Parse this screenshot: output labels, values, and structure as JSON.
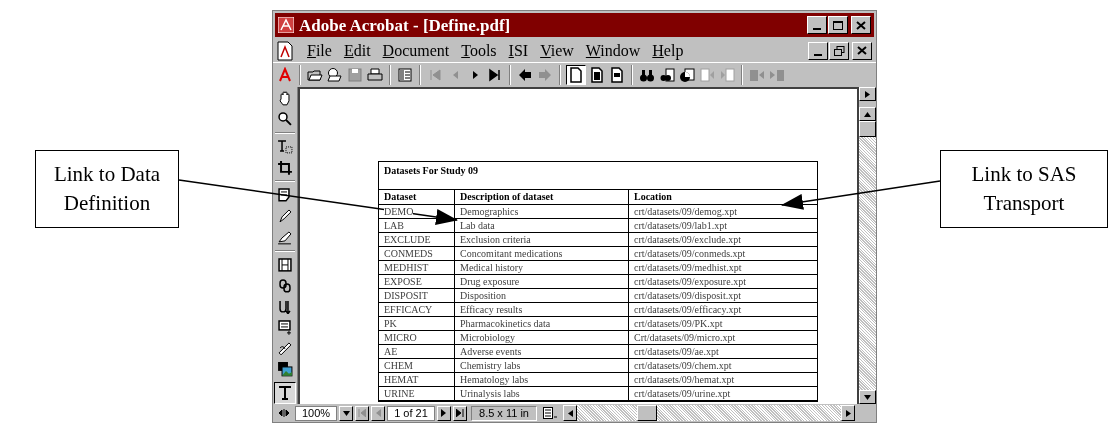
{
  "callouts": [
    {
      "text": "Link to Data Definition"
    },
    {
      "text": "Link to SAS Transport"
    }
  ],
  "window": {
    "title": "Adobe Acrobat - [Define.pdf]"
  },
  "menu": [
    {
      "label": "File"
    },
    {
      "label": "Edit"
    },
    {
      "label": "Document"
    },
    {
      "label": "Tools"
    },
    {
      "label": "ISI"
    },
    {
      "label": "View"
    },
    {
      "label": "Window"
    },
    {
      "label": "Help"
    }
  ],
  "document": {
    "table": {
      "title": "Datasets For Study 09",
      "columns": [
        "Dataset",
        "Description of dataset",
        "Location"
      ],
      "rows": [
        [
          "DEMO",
          "Demographics",
          "crt/datasets/09/demog.xpt"
        ],
        [
          "LAB",
          "Lab data",
          "crt/datasets/09/lab1.xpt"
        ],
        [
          "EXCLUDE",
          "Exclusion criteria",
          "crt/datasets/09/exclude.xpt"
        ],
        [
          "CONMEDS",
          "Concomitant medications",
          "crt/datasets/09/conmeds.xpt"
        ],
        [
          "MEDHIST",
          "Medical history",
          "crt/datasets/09/medhist.xpt"
        ],
        [
          "EXPOSE",
          "Drug exposure",
          "crt/datasets/09/exposure.xpt"
        ],
        [
          "DISPOSIT",
          "Disposition",
          "crt/datasets/09/disposit.xpt"
        ],
        [
          "EFFICACY",
          "Efficacy results",
          "crt/datasets/09/efficacy.xpt"
        ],
        [
          "PK",
          "Pharmacokinetics data",
          "crt/datasets/09/PK.xpt"
        ],
        [
          "MICRO",
          "Microbiology",
          "Crt/datasets/09/micro.xpt"
        ],
        [
          "AE",
          "Adverse events",
          "crt/datasets/09/ae.xpt"
        ],
        [
          "CHEM",
          "Chemistry labs",
          "crt/datasets/09/chem.xpt"
        ],
        [
          "HEMAT",
          "Hematology labs",
          "crt/datasets/09/hemat.xpt"
        ],
        [
          "URINE",
          "Urinalysis labs",
          "crt/datasets/09/urine.xpt"
        ]
      ]
    }
  },
  "status_bar": {
    "zoom": "100%",
    "page": "1 of 21",
    "page_size": "8.5 x 11 in"
  }
}
